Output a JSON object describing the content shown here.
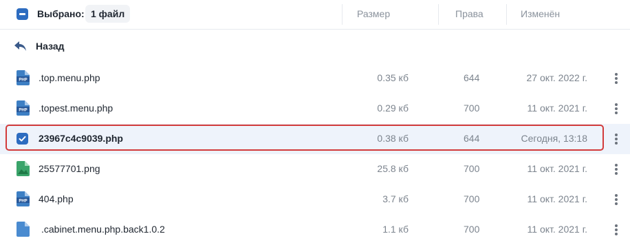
{
  "header": {
    "selected_label": "Выбрано:",
    "selected_count": "1 файл",
    "col_size": "Размер",
    "col_perms": "Права",
    "col_modified": "Изменён"
  },
  "back": {
    "label": "Назад"
  },
  "files": [
    {
      "name": ".top.menu.php",
      "size": "0.35 кб",
      "perms": "644",
      "modified": "27 окт. 2022 г.",
      "icon": "php-file-icon"
    },
    {
      "name": ".topest.menu.php",
      "size": "0.29 кб",
      "perms": "700",
      "modified": "11 окт. 2021 г.",
      "icon": "php-file-icon"
    },
    {
      "name": "23967c4c9039.php",
      "size": "0.38 кб",
      "perms": "644",
      "modified": "Сегодня, 13:18",
      "icon": "checkbox-checked-icon",
      "selected": true
    },
    {
      "name": "25577701.png",
      "size": "25.8 кб",
      "perms": "700",
      "modified": "11 окт. 2021 г.",
      "icon": "image-file-icon"
    },
    {
      "name": "404.php",
      "size": "3.7 кб",
      "perms": "700",
      "modified": "11 окт. 2021 г.",
      "icon": "php-file-icon"
    },
    {
      "name": ".cabinet.menu.php.back1.0.2",
      "size": "1.1 кб",
      "perms": "700",
      "modified": "11 окт. 2021 г.",
      "icon": "generic-file-icon"
    }
  ],
  "colors": {
    "accent": "#2d6cc0",
    "selection_border": "#d23a3a",
    "selected_row_bg": "#eef3fb",
    "php_icon": "#3d7fc4",
    "image_icon": "#3aa46a"
  }
}
